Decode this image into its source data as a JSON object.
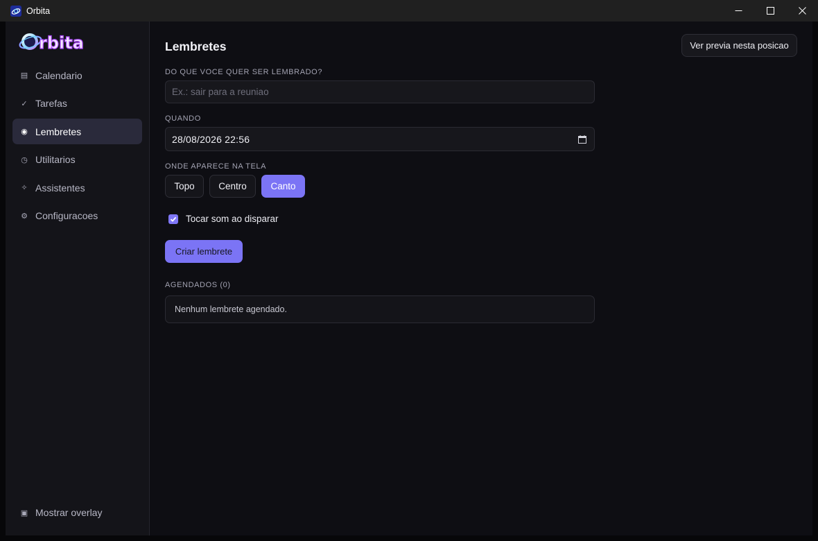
{
  "window": {
    "title": "Orbita",
    "icon": "orbita-app-icon",
    "controls": [
      "minimize-icon",
      "maximize-icon",
      "close-icon"
    ]
  },
  "sidebar": {
    "logo_text": "Orbita",
    "items": [
      {
        "label": "Calendario",
        "icon": "list-icon",
        "glyph": "▤",
        "active": false
      },
      {
        "label": "Tarefas",
        "icon": "check-icon",
        "glyph": "✓",
        "active": false
      },
      {
        "label": "Lembretes",
        "icon": "radio-dot-icon",
        "glyph": "◉",
        "active": true
      },
      {
        "label": "Utilitarios",
        "icon": "clock-icon",
        "glyph": "◷",
        "active": false
      },
      {
        "label": "Assistentes",
        "icon": "sparkle-icon",
        "glyph": "✧",
        "active": false
      },
      {
        "label": "Configuracoes",
        "icon": "gear-icon",
        "glyph": "⚙",
        "active": false
      }
    ],
    "bottom": {
      "label": "Mostrar overlay",
      "icon": "overlay-square-icon",
      "glyph": "▣"
    }
  },
  "main": {
    "title": "Lembretes",
    "preview_button": "Ver previa nesta posicao",
    "reminder_label": "DO QUE VOCE QUER SER LEMBRADO?",
    "reminder_value": "",
    "reminder_placeholder": "Ex.: sair para a reuniao",
    "when_label": "QUANDO",
    "when_value": "28/08/2026  22:56",
    "position_label": "ONDE APARECE NA TELA",
    "positions": [
      {
        "label": "Topo",
        "selected": false
      },
      {
        "label": "Centro",
        "selected": false
      },
      {
        "label": "Canto",
        "selected": true
      }
    ],
    "sound_checkbox_label": "Tocar som ao disparar",
    "sound_checked": true,
    "create_button": "Criar lembrete",
    "scheduled_label": "AGENDADOS (0)",
    "empty_text": "Nenhum lembrete agendado."
  },
  "colors": {
    "accent": "#7b74f5",
    "sidebar_bg": "#141419",
    "main_bg": "#0e0e13",
    "active_item_bg": "#2a2a3b"
  }
}
